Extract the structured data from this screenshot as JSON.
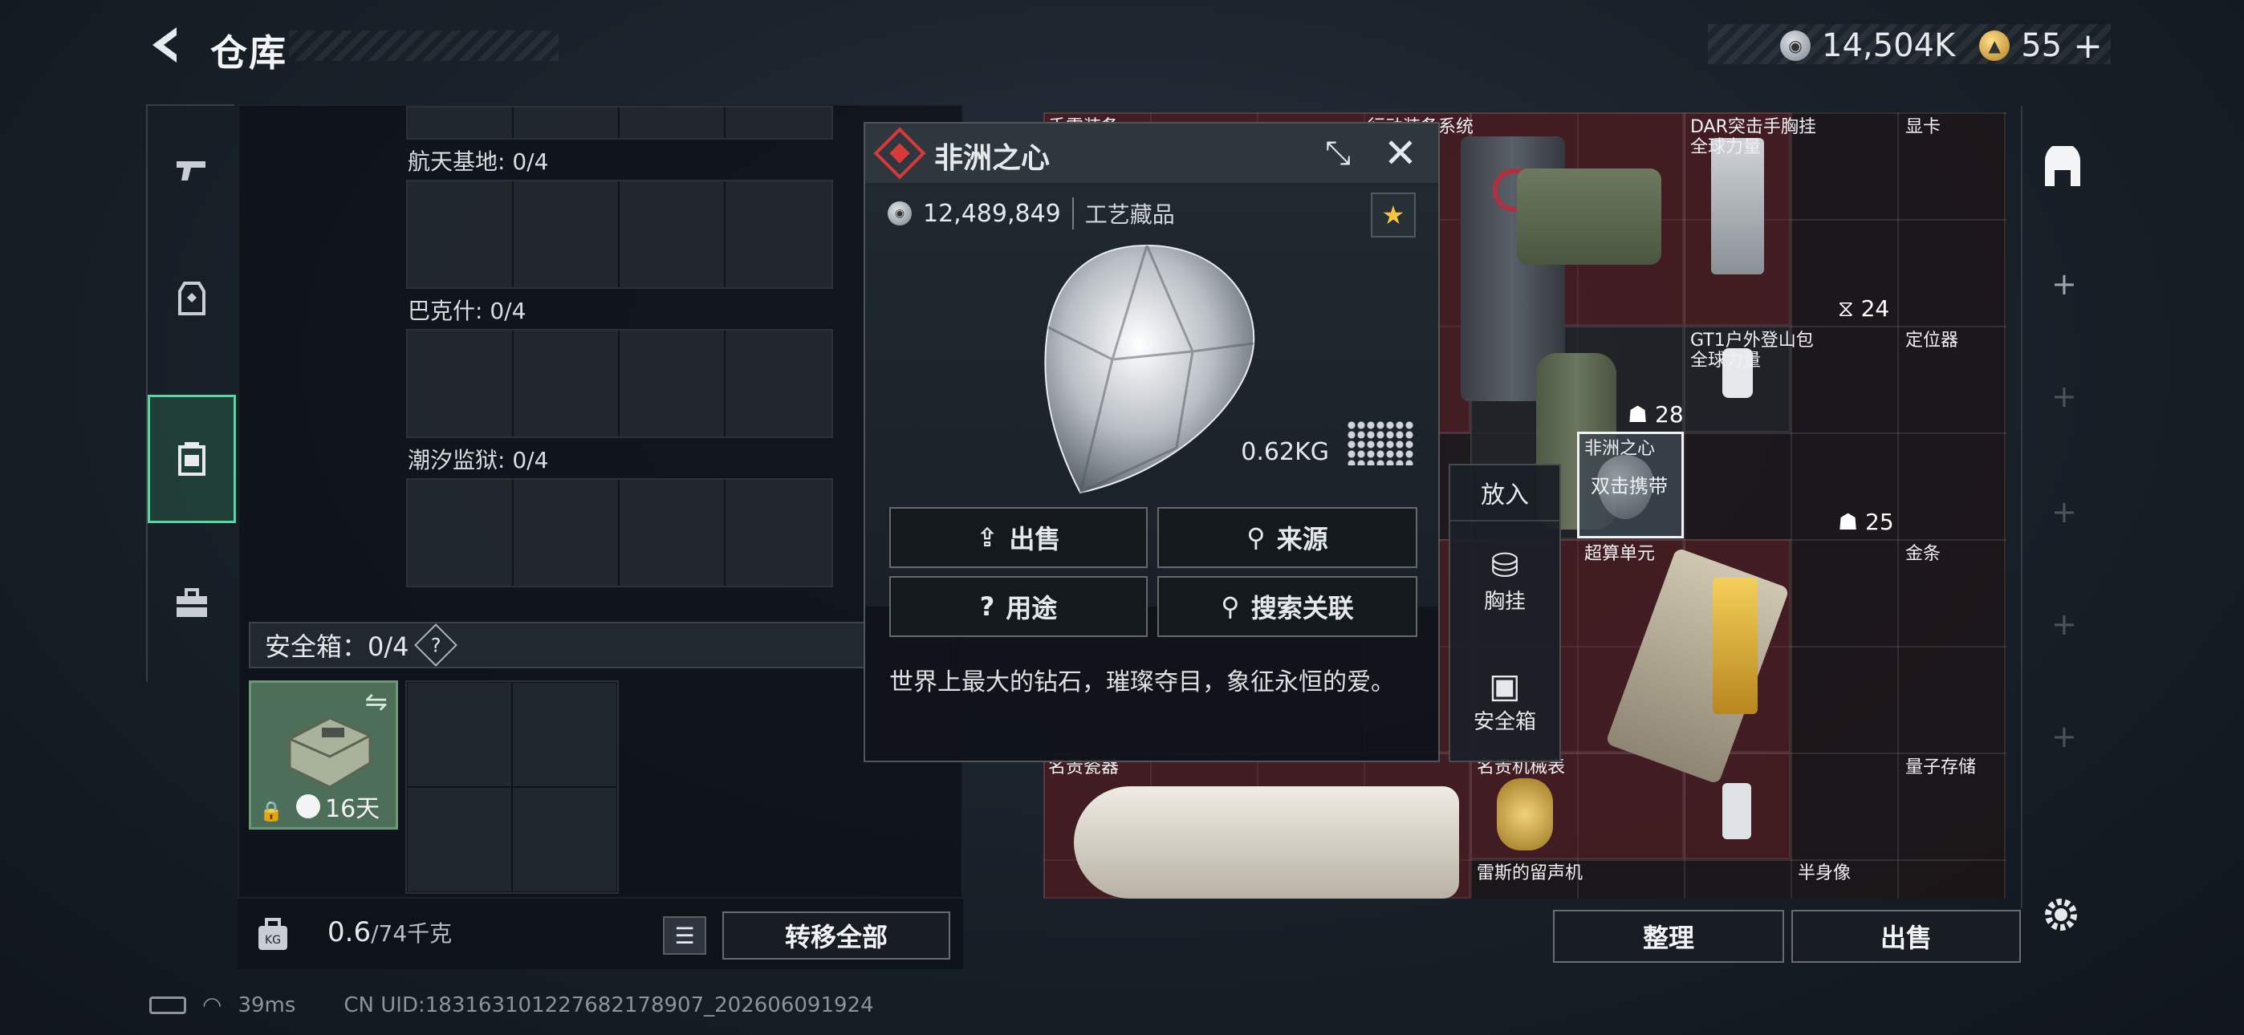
{
  "header": {
    "title": "仓库",
    "currency_silver": "14,504K",
    "currency_gold": "55",
    "gold_plus": "+"
  },
  "nav": {
    "items": [
      {
        "icon": "pistol-icon",
        "active": false
      },
      {
        "icon": "vest-icon",
        "active": false
      },
      {
        "icon": "backpack-icon",
        "active": true
      },
      {
        "icon": "toolbox-icon",
        "active": false
      }
    ]
  },
  "stash": {
    "sections": [
      {
        "label": "航天基地: 0/4"
      },
      {
        "label": "巴克什: 0/4"
      },
      {
        "label": "潮汐监狱: 0/4"
      }
    ],
    "safebox_label": "安全箱：0/4",
    "safebox_help": "?",
    "safebox_days": "16天",
    "weight_value": "0.6",
    "weight_total": "/74千克",
    "transfer_all": "转移全部"
  },
  "inventory": {
    "items": [
      {
        "label": "手雷装备",
        "name": "item-grenade-gear"
      },
      {
        "label": "行动装备系统",
        "name": "item-tactical-system"
      },
      {
        "label": "DAR突击手胸挂\n全球力量",
        "name": "item-dar-chest-rig"
      },
      {
        "label": "显卡",
        "name": "item-graphics-card"
      },
      {
        "label": "GT1户外登山包\n全球力量",
        "name": "item-gt1-backpack"
      },
      {
        "label": "定位器",
        "name": "item-locator"
      },
      {
        "label": "超算单元",
        "name": "item-supercomputer-unit"
      },
      {
        "label": "金条",
        "name": "item-gold-bar"
      },
      {
        "label": "名贵瓷器",
        "name": "item-porcelain"
      },
      {
        "label": "名贵机械表",
        "name": "item-watch"
      },
      {
        "label": "量子存储",
        "name": "item-quantum-storage"
      },
      {
        "label": "雷斯的留声机",
        "name": "item-gramophone"
      },
      {
        "label": "半身像",
        "name": "item-bust"
      }
    ],
    "counts": {
      "dar": "24",
      "tactical": "28",
      "gt1": "25"
    },
    "highlight_title": "非洲之心",
    "highlight_hint": "双击携带",
    "sort_button": "整理",
    "sell_button": "出售"
  },
  "put_panel": {
    "title": "放入",
    "chest": "胸挂",
    "safebox": "安全箱"
  },
  "popup": {
    "title": "非洲之心",
    "price": "12,489,849",
    "category": "工艺藏品",
    "weight": "0.62KG",
    "sell": "出售",
    "source": "来源",
    "usage": "用途",
    "search_related": "搜索关联",
    "description": "世界上最大的钻石，璀璨夺目，象征永恒的爱。"
  },
  "status": {
    "ping": "39ms",
    "uid": "CN UID:183163101227682178907_202606091924"
  },
  "colors": {
    "accent_green": "#58d6a0",
    "item_red": "#6e232d",
    "ruby": "#d83a3a",
    "star": "#f5c542"
  }
}
